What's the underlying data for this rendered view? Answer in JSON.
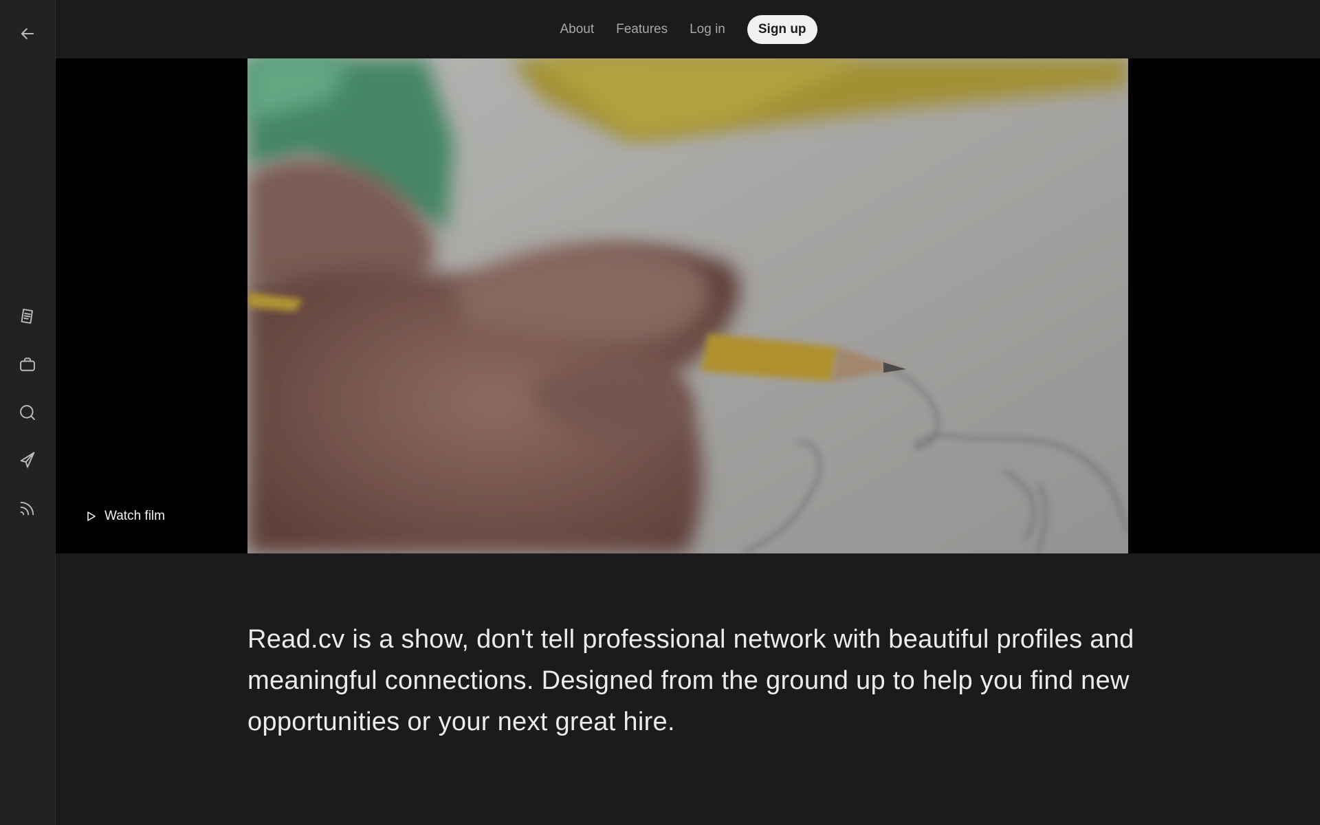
{
  "sidebar": {
    "back_icon": "arrow-left-icon",
    "items": [
      {
        "icon": "document-icon",
        "name": "profile"
      },
      {
        "icon": "briefcase-icon",
        "name": "jobs"
      },
      {
        "icon": "search-icon",
        "name": "search"
      },
      {
        "icon": "send-icon",
        "name": "messages"
      },
      {
        "icon": "rss-feed-icon",
        "name": "feed"
      }
    ]
  },
  "nav": {
    "about": "About",
    "features": "Features",
    "login": "Log in",
    "signup": "Sign up"
  },
  "hero": {
    "watch_label": "Watch film",
    "watch_icon": "play-icon"
  },
  "tagline": "Read.cv is a show, don't tell professional network with beautiful profiles and meaningful connections. Designed from the ground up to help you find new opportunities or your next great hire.",
  "colors": {
    "background": "#1b1b1b",
    "sidebar": "#222222",
    "hero_letterbox": "#000000",
    "button_bg": "#f1f1f1"
  }
}
